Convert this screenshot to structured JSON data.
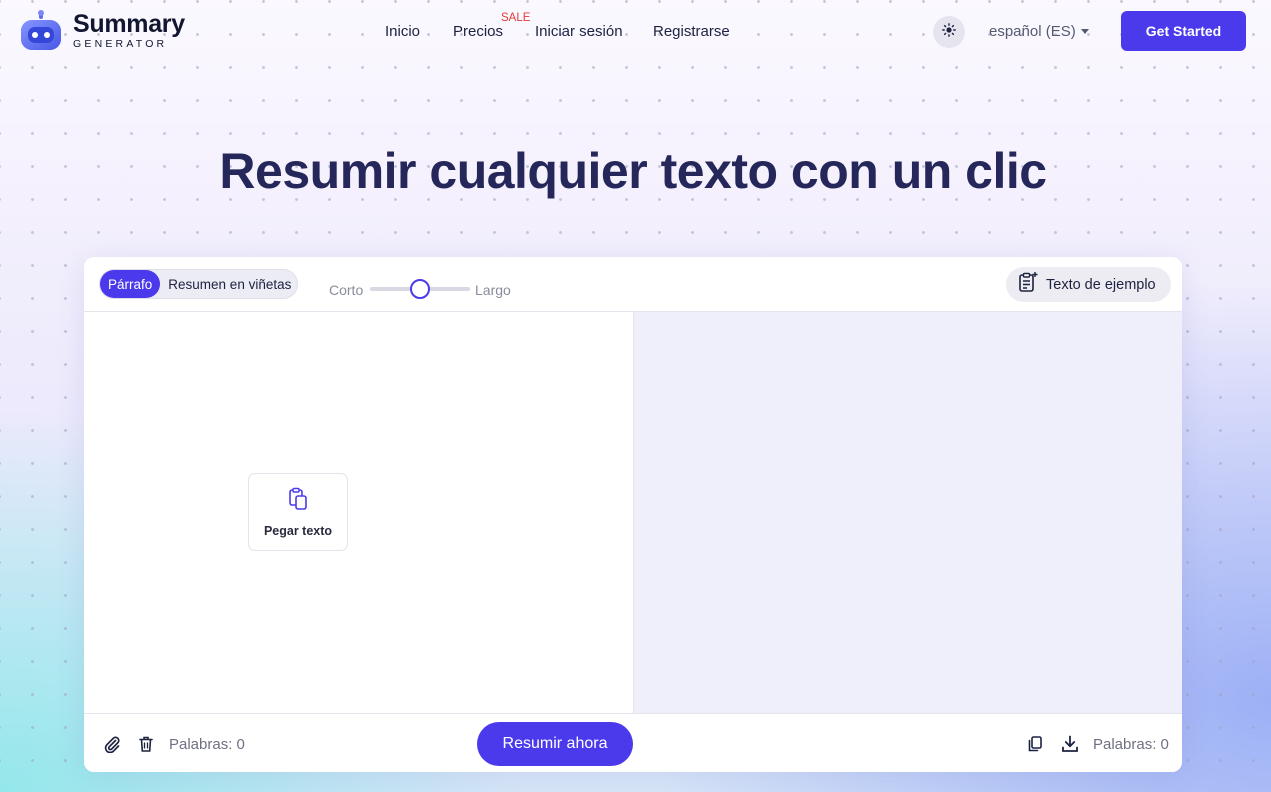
{
  "brand": {
    "name": "Summary",
    "tagline": "GENERATOR"
  },
  "nav": {
    "items": [
      {
        "label": "Inicio"
      },
      {
        "label": "Precios",
        "badge": "SALE"
      },
      {
        "label": "Iniciar sesión"
      },
      {
        "label": "Registrarse"
      }
    ],
    "theme_icon": "sun-icon",
    "language": "español (ES)",
    "cta": "Get Started"
  },
  "hero": {
    "title": "Resumir cualquier texto con un clic"
  },
  "editor": {
    "modes": {
      "active": "Párrafo",
      "other": "Resumen en viñetas"
    },
    "length": {
      "min_label": "Corto",
      "max_label": "Largo",
      "value": 0.5
    },
    "sample_button": "Texto de ejemplo",
    "paste_button": "Pegar texto",
    "input_word_count": "Palabras: 0",
    "output_word_count": "Palabras: 0",
    "summarize_button": "Resumir ahora"
  },
  "colors": {
    "accent": "#4a3aeb",
    "title": "#25275a",
    "sale": "#e23b3b",
    "output_bg": "#efeffc"
  }
}
